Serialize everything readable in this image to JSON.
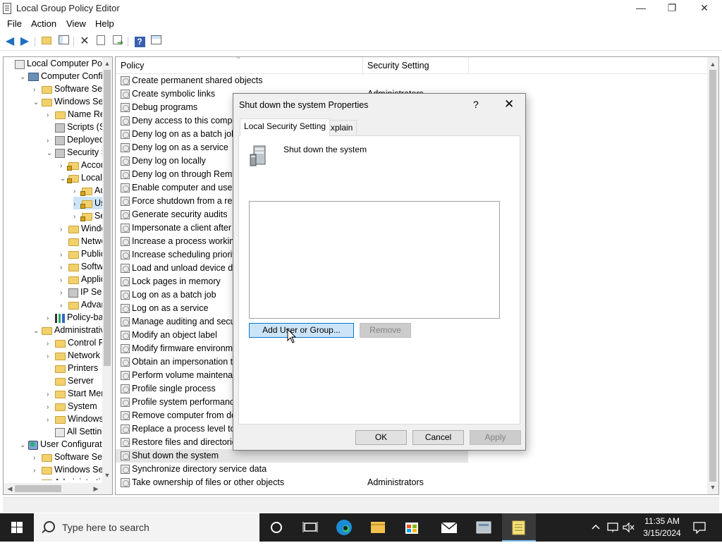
{
  "window": {
    "title": "Local Group Policy Editor",
    "minimize_glyph": "—",
    "restore_glyph": "❐",
    "close_glyph": "✕"
  },
  "menu": [
    "File",
    "Action",
    "View",
    "Help"
  ],
  "toolbar_icons": [
    "back-arrow-icon",
    "forward-arrow-icon",
    "up-folder-icon",
    "show-hide-tree-icon",
    "delete-icon",
    "properties-icon",
    "export-list-icon",
    "help-icon",
    "console-view-icon"
  ],
  "tree": {
    "items": [
      {
        "label": "Local Computer Polic",
        "indent": 0,
        "chev": "",
        "icon": "policy"
      },
      {
        "label": "Computer Config",
        "indent": 1,
        "chev": "v",
        "icon": "computer"
      },
      {
        "label": "Software Setti",
        "indent": 2,
        "chev": ">",
        "icon": "folder"
      },
      {
        "label": "Windows Sett",
        "indent": 2,
        "chev": "v",
        "icon": "folder"
      },
      {
        "label": "Name Res",
        "indent": 3,
        "chev": ">",
        "icon": "folder"
      },
      {
        "label": "Scripts (Sta",
        "indent": 3,
        "chev": "",
        "icon": "script"
      },
      {
        "label": "Deployed",
        "indent": 3,
        "chev": ">",
        "icon": "printer"
      },
      {
        "label": "Security Se",
        "indent": 3,
        "chev": "v",
        "icon": "security"
      },
      {
        "label": "Accou",
        "indent": 4,
        "chev": ">",
        "icon": "lockfolder"
      },
      {
        "label": "Local P",
        "indent": 4,
        "chev": "v",
        "icon": "lockfolder"
      },
      {
        "label": "Au",
        "indent": 5,
        "chev": ">",
        "icon": "lockfolder"
      },
      {
        "label": "Use",
        "indent": 5,
        "chev": ">",
        "icon": "lockfolder",
        "selected": true
      },
      {
        "label": "Sec",
        "indent": 5,
        "chev": ">",
        "icon": "lockfolder"
      },
      {
        "label": "Windo",
        "indent": 4,
        "chev": ">",
        "icon": "folder"
      },
      {
        "label": "Netwo",
        "indent": 4,
        "chev": "",
        "icon": "folder"
      },
      {
        "label": "Public",
        "indent": 4,
        "chev": ">",
        "icon": "folder"
      },
      {
        "label": "Softwa",
        "indent": 4,
        "chev": ">",
        "icon": "folder"
      },
      {
        "label": "Applic",
        "indent": 4,
        "chev": ">",
        "icon": "folder"
      },
      {
        "label": "IP Secu",
        "indent": 4,
        "chev": ">",
        "icon": "ipsec"
      },
      {
        "label": "Advan",
        "indent": 4,
        "chev": ">",
        "icon": "folder"
      },
      {
        "label": "Policy-bas",
        "indent": 3,
        "chev": ">",
        "icon": "chart"
      },
      {
        "label": "Administrative",
        "indent": 2,
        "chev": "v",
        "icon": "folder"
      },
      {
        "label": "Control Pa",
        "indent": 3,
        "chev": ">",
        "icon": "folder"
      },
      {
        "label": "Network",
        "indent": 3,
        "chev": ">",
        "icon": "folder"
      },
      {
        "label": "Printers",
        "indent": 3,
        "chev": "",
        "icon": "folder"
      },
      {
        "label": "Server",
        "indent": 3,
        "chev": "",
        "icon": "folder"
      },
      {
        "label": "Start Menu",
        "indent": 3,
        "chev": ">",
        "icon": "folder"
      },
      {
        "label": "System",
        "indent": 3,
        "chev": ">",
        "icon": "folder"
      },
      {
        "label": "Windows (",
        "indent": 3,
        "chev": ">",
        "icon": "folder"
      },
      {
        "label": "All Setting",
        "indent": 3,
        "chev": "",
        "icon": "allsettings"
      },
      {
        "label": "User Configuratio",
        "indent": 1,
        "chev": "v",
        "icon": "user"
      },
      {
        "label": "Software Setti",
        "indent": 2,
        "chev": ">",
        "icon": "folder"
      },
      {
        "label": "Windows Sett",
        "indent": 2,
        "chev": ">",
        "icon": "folder"
      },
      {
        "label": "Administrativ",
        "indent": 2,
        "chev": ">",
        "icon": "folder"
      }
    ]
  },
  "list": {
    "columns": [
      "Policy",
      "Security Setting"
    ],
    "rows": [
      {
        "policy": "Create permanent shared objects",
        "setting": ""
      },
      {
        "policy": "Create symbolic links",
        "setting": "Administrators"
      },
      {
        "policy": "Debug programs",
        "setting": ""
      },
      {
        "policy": "Deny access to this comput",
        "setting": ""
      },
      {
        "policy": "Deny log on as a batch job",
        "setting": ""
      },
      {
        "policy": "Deny log on as a service",
        "setting": ""
      },
      {
        "policy": "Deny log on locally",
        "setting": ""
      },
      {
        "policy": "Deny log on through Remo",
        "setting": ""
      },
      {
        "policy": "Enable computer and user a",
        "setting": ""
      },
      {
        "policy": "Force shutdown from a rem",
        "setting": ""
      },
      {
        "policy": "Generate security audits",
        "setting": ""
      },
      {
        "policy": "Impersonate a client after a",
        "setting": ""
      },
      {
        "policy": "Increase a process working",
        "setting": ""
      },
      {
        "policy": "Increase scheduling priority",
        "setting": ""
      },
      {
        "policy": "Load and unload device dri",
        "setting": ""
      },
      {
        "policy": "Lock pages in memory",
        "setting": ""
      },
      {
        "policy": "Log on as a batch job",
        "setting": ""
      },
      {
        "policy": "Log on as a service",
        "setting": ""
      },
      {
        "policy": "Manage auditing and secur",
        "setting": ""
      },
      {
        "policy": "Modify an object label",
        "setting": ""
      },
      {
        "policy": "Modify firmware environm",
        "setting": ""
      },
      {
        "policy": "Obtain an impersonation to",
        "setting": ""
      },
      {
        "policy": "Perform volume maintenan",
        "setting": ""
      },
      {
        "policy": "Profile single process",
        "setting": ""
      },
      {
        "policy": "Profile system performance",
        "setting": ""
      },
      {
        "policy": "Remove computer from do",
        "setting": ""
      },
      {
        "policy": "Replace a process level toke",
        "setting": ""
      },
      {
        "policy": "Restore files and directories",
        "setting": ""
      },
      {
        "policy": "Shut down the system",
        "setting": "",
        "selected": true
      },
      {
        "policy": "Synchronize directory service data",
        "setting": ""
      },
      {
        "policy": "Take ownership of files or other objects",
        "setting": "Administrators"
      }
    ]
  },
  "dialog": {
    "title": "Shut down the system Properties",
    "help_glyph": "?",
    "close_glyph": "✕",
    "tabs": [
      "Local Security Setting",
      "Explain"
    ],
    "active_tab": 0,
    "policy_name": "Shut down the system",
    "add_button": "Add User or Group...",
    "remove_button": "Remove",
    "ok_button": "OK",
    "cancel_button": "Cancel",
    "apply_button": "Apply"
  },
  "taskbar": {
    "search_placeholder": "Type here to search",
    "apps": [
      "cortana-icon",
      "task-view-icon",
      "edge-icon",
      "file-explorer-icon",
      "store-icon",
      "mail-icon",
      "group-policy-icon",
      "notepad-icon"
    ],
    "time": "11:35 AM",
    "date": "3/15/2024"
  },
  "colors": {
    "selection": "#cce4f7",
    "taskbar": "#1f1f1f",
    "accent": "#0078d7"
  }
}
